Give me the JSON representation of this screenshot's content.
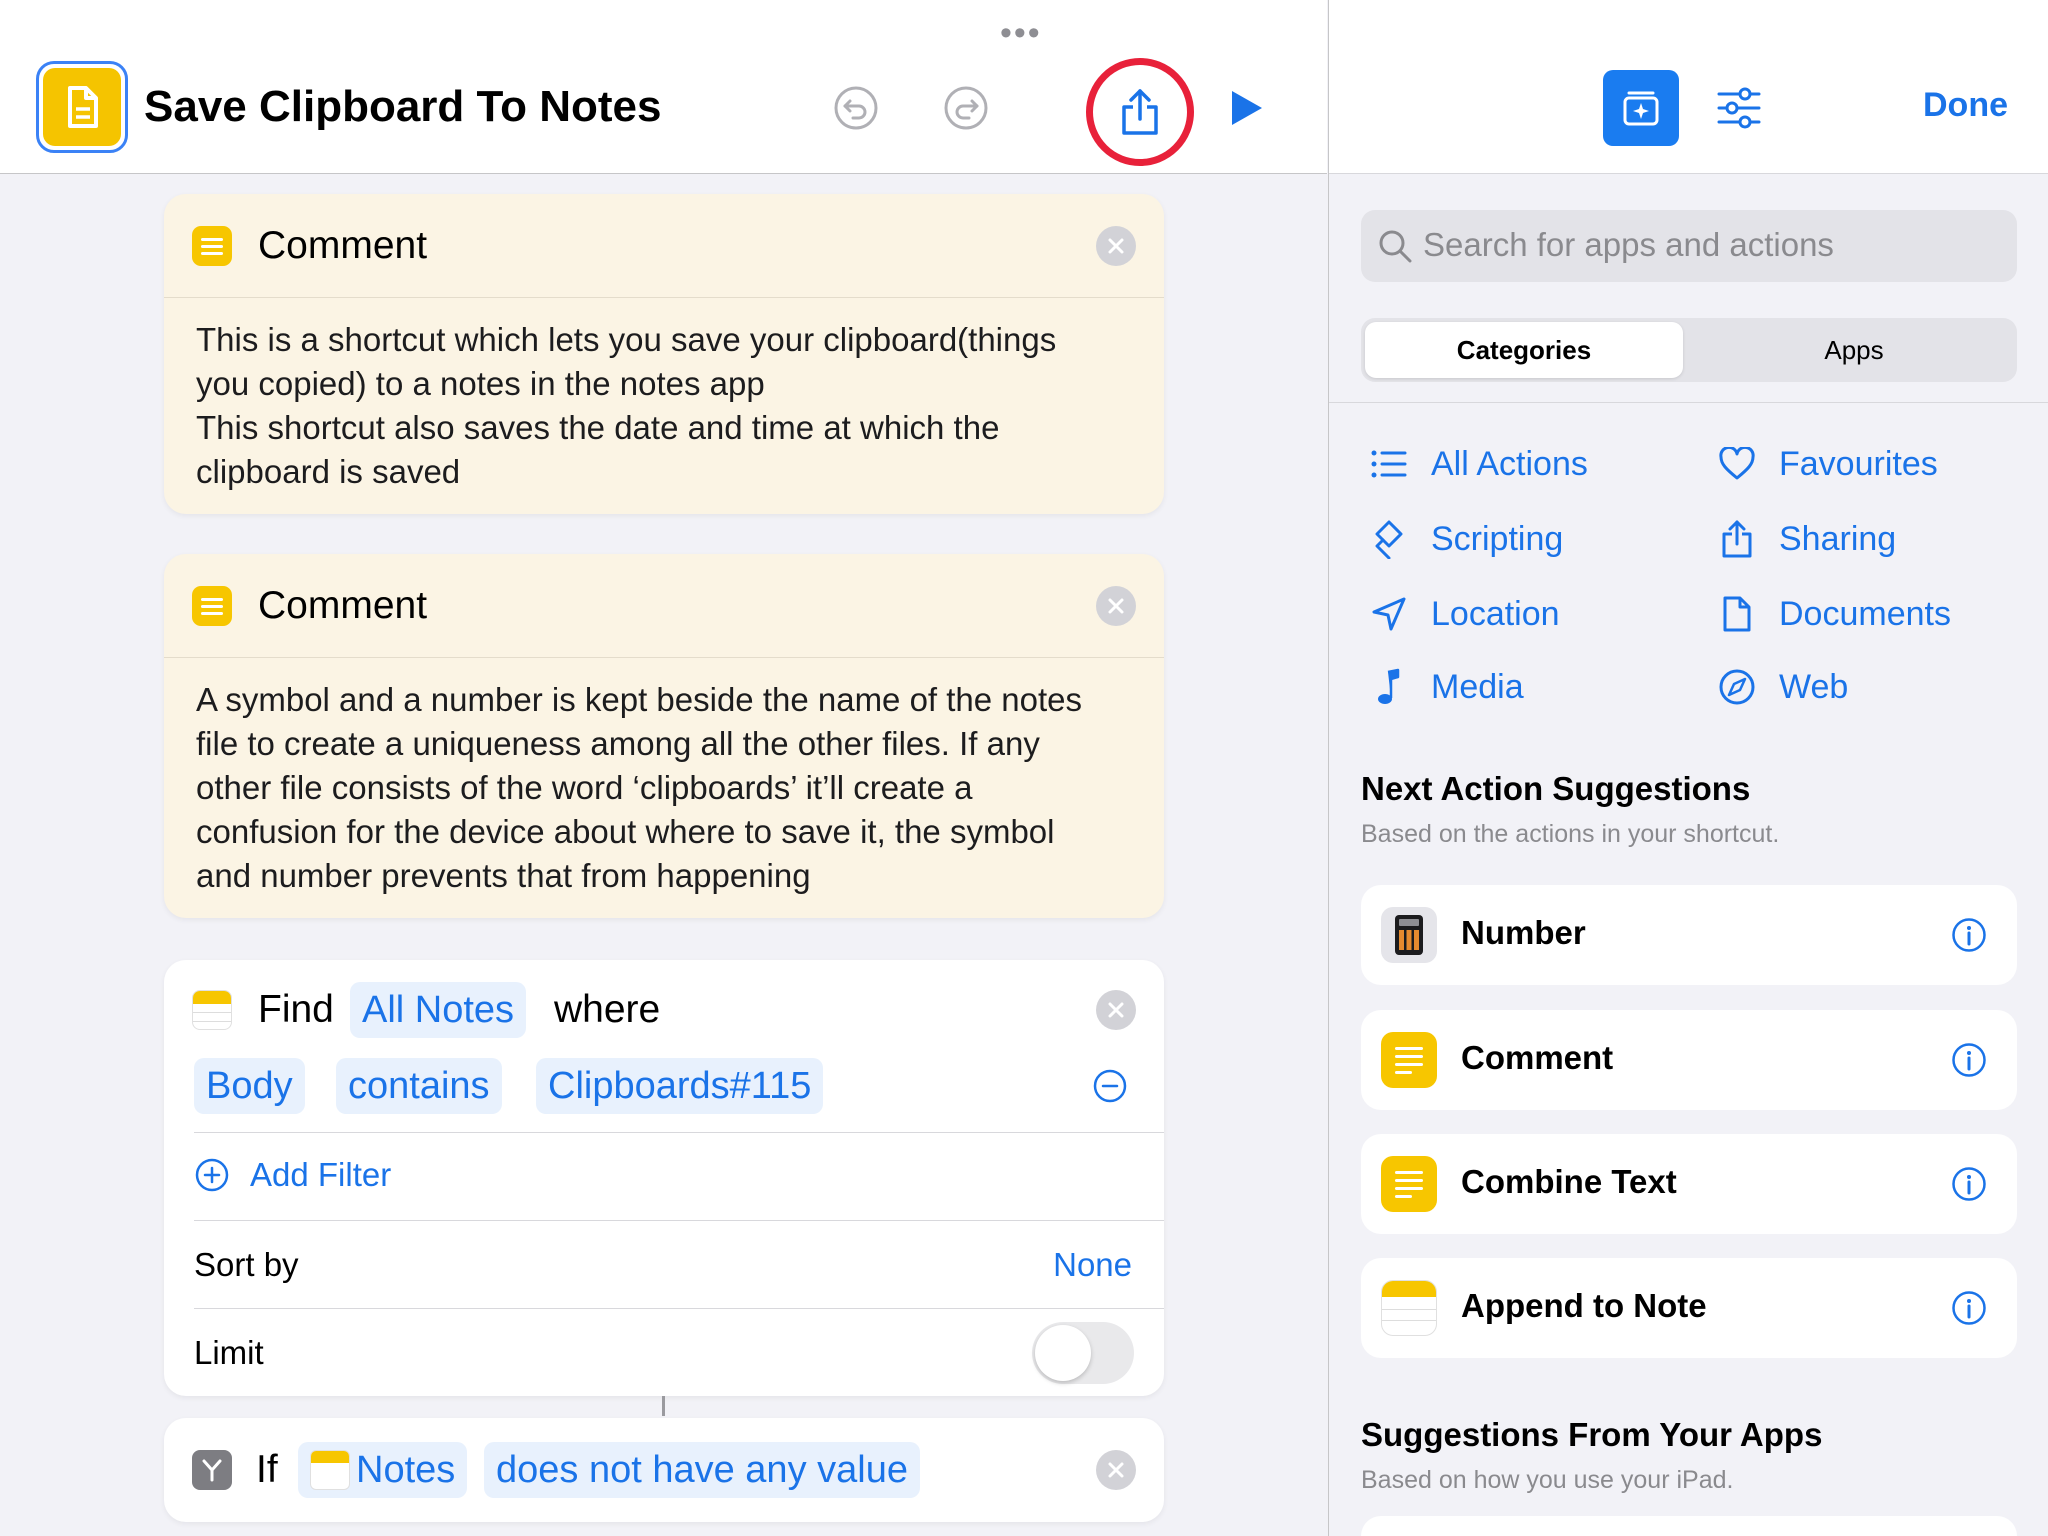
{
  "editor": {
    "title": "Save Clipboard To Notes",
    "more_dots": "•••",
    "comments": [
      {
        "title": "Comment",
        "lines": [
          "This is a shortcut which lets you save your clipboard(things",
          "you copied) to a notes in the notes app",
          "This shortcut also saves the date and time at which the",
          "clipboard is saved"
        ]
      },
      {
        "title": "Comment",
        "lines": [
          "A symbol and a number is kept beside the name of the notes",
          "file to create a uniqueness among all the other files. If any",
          "other file consists of the word ‘clipboards’ it’ll create a",
          "confusion for the device about where to save it, the symbol",
          "and number prevents that from happening"
        ]
      }
    ],
    "find": {
      "verb": "Find",
      "source": "All Notes",
      "where": "where",
      "filter_field": "Body",
      "filter_operator": "contains",
      "filter_value": "Clipboards#115",
      "add_filter": "Add Filter",
      "sort_label": "Sort by",
      "sort_value": "None",
      "limit_label": "Limit",
      "limit_on": false
    },
    "if_action": {
      "keyword": "If",
      "variable": "Notes",
      "condition": "does not have any value"
    }
  },
  "library": {
    "done": "Done",
    "search_placeholder": "Search for apps and actions",
    "segments": [
      "Categories",
      "Apps"
    ],
    "selected_segment": "Categories",
    "categories": [
      {
        "label": "All Actions",
        "icon": "list-icon"
      },
      {
        "label": "Favourites",
        "icon": "heart-icon"
      },
      {
        "label": "Scripting",
        "icon": "scripting-icon"
      },
      {
        "label": "Sharing",
        "icon": "share-icon"
      },
      {
        "label": "Location",
        "icon": "location-arrow-icon"
      },
      {
        "label": "Documents",
        "icon": "document-icon"
      },
      {
        "label": "Media",
        "icon": "music-note-icon"
      },
      {
        "label": "Web",
        "icon": "compass-icon"
      }
    ],
    "next_title": "Next Action Suggestions",
    "next_subtitle": "Based on the actions in your shortcut.",
    "suggestions": [
      {
        "label": "Number",
        "icon": "calculator-icon"
      },
      {
        "label": "Comment",
        "icon": "text-lines-icon"
      },
      {
        "label": "Combine Text",
        "icon": "text-lines-icon"
      },
      {
        "label": "Append to Note",
        "icon": "notes-icon"
      }
    ],
    "apps_title": "Suggestions From Your Apps",
    "apps_subtitle": "Based on how you use your iPad."
  },
  "colors": {
    "accent": "#1a73e8",
    "share_highlight": "#e8213a",
    "comment_bg": "#fbf4e4",
    "notes_yellow": "#f7c600"
  }
}
